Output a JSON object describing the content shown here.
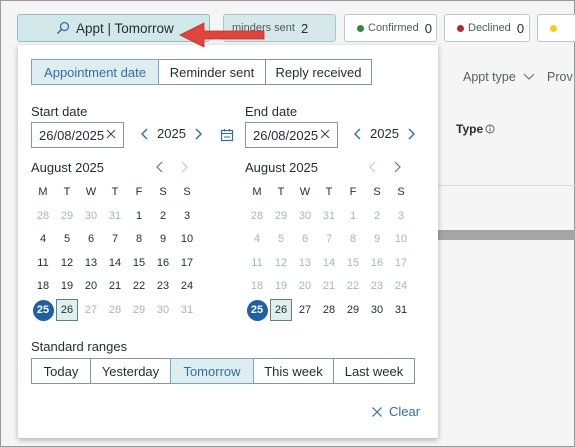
{
  "filters": {
    "appt_chip_label": "Appt | Tomorrow",
    "reminders": {
      "label": "minders sent",
      "count": "2"
    },
    "confirmed": {
      "label": "Confirmed",
      "count": "0",
      "color": "#2e8b3a"
    },
    "declined": {
      "label": "Declined",
      "count": "0",
      "color": "#b02a3a"
    },
    "unknown_color": "#e8d21f"
  },
  "background_table": {
    "appt_type_header": "Appt type",
    "prov_header": "Prov",
    "type_header": "Type"
  },
  "panel": {
    "tabs": [
      {
        "label": "Appointment date",
        "active": true
      },
      {
        "label": "Reminder sent",
        "active": false
      },
      {
        "label": "Reply received",
        "active": false
      }
    ],
    "start": {
      "label": "Start date",
      "value": "26/08/2025",
      "year": "2025",
      "month_title": "August 2025",
      "weekdays": [
        "M",
        "T",
        "W",
        "T",
        "F",
        "S",
        "S"
      ],
      "weeks": [
        [
          "28",
          "29",
          "30",
          "31",
          "1",
          "2",
          "3"
        ],
        [
          "4",
          "5",
          "6",
          "7",
          "8",
          "9",
          "10"
        ],
        [
          "11",
          "12",
          "13",
          "14",
          "15",
          "16",
          "17"
        ],
        [
          "18",
          "19",
          "20",
          "21",
          "22",
          "23",
          "24"
        ],
        [
          "25",
          "26",
          "27",
          "28",
          "29",
          "30",
          "31"
        ]
      ]
    },
    "end": {
      "label": "End date",
      "value": "26/08/2025",
      "year": "2025",
      "month_title": "August 2025",
      "weekdays": [
        "M",
        "T",
        "W",
        "T",
        "F",
        "S",
        "S"
      ],
      "weeks": [
        [
          "28",
          "29",
          "30",
          "31",
          "1",
          "2",
          "3"
        ],
        [
          "4",
          "5",
          "6",
          "7",
          "8",
          "9",
          "10"
        ],
        [
          "11",
          "12",
          "13",
          "14",
          "15",
          "16",
          "17"
        ],
        [
          "18",
          "19",
          "20",
          "21",
          "22",
          "23",
          "24"
        ],
        [
          "25",
          "26",
          "27",
          "28",
          "29",
          "30",
          "31"
        ]
      ]
    },
    "standard_ranges": {
      "label": "Standard ranges",
      "options": [
        {
          "label": "Today",
          "active": false
        },
        {
          "label": "Yesterday",
          "active": false
        },
        {
          "label": "Tomorrow",
          "active": true
        },
        {
          "label": "This week",
          "active": false
        },
        {
          "label": "Last week",
          "active": false
        }
      ]
    },
    "clear_label": "Clear"
  }
}
